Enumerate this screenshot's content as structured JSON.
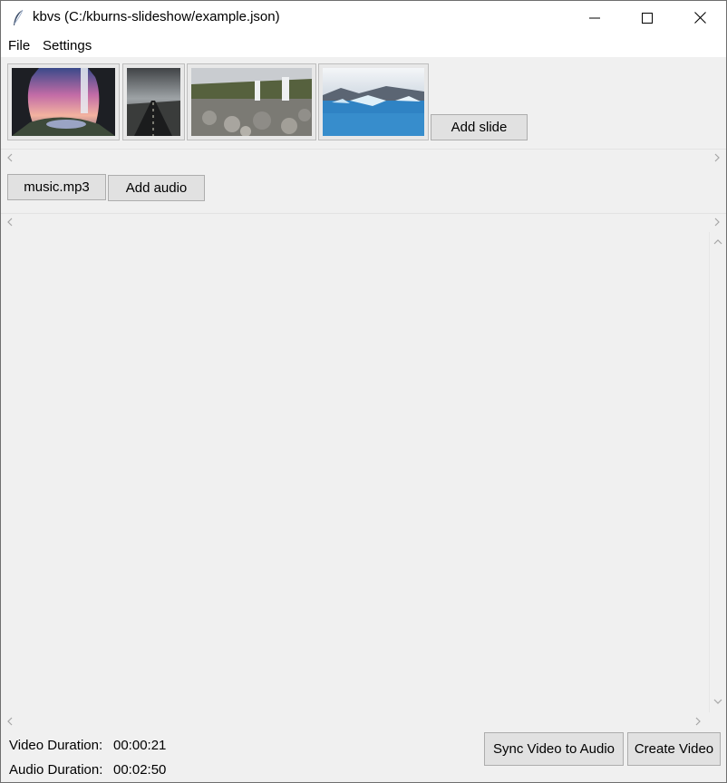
{
  "window": {
    "title": "kbvs (C:/kburns-slideshow/example.json)",
    "app_icon": "feather-icon"
  },
  "menu": {
    "items": [
      "File",
      "Settings"
    ]
  },
  "slides": {
    "thumbnails": [
      {
        "name": "slide-waterfall-cave",
        "description": "waterfall at sunset"
      },
      {
        "name": "slide-road",
        "description": "road into fog"
      },
      {
        "name": "slide-waterfall-rocks",
        "description": "waterfall with rocks"
      },
      {
        "name": "slide-glacier-lagoon",
        "description": "glacier lagoon icebergs"
      }
    ],
    "add_label": "Add slide"
  },
  "audio": {
    "files": [
      "music.mp3"
    ],
    "add_label": "Add audio"
  },
  "status": {
    "video_label": "Video Duration:",
    "video_value": "00:00:21",
    "audio_label": "Audio Duration:",
    "audio_value": "00:02:50"
  },
  "actions": {
    "sync_label": "Sync Video to Audio",
    "create_label": "Create Video"
  },
  "colors": {
    "window_bg": "#f0f0f0",
    "button_bg": "#e1e1e1",
    "button_border": "#adadad",
    "titlebar_bg": "#ffffff"
  }
}
